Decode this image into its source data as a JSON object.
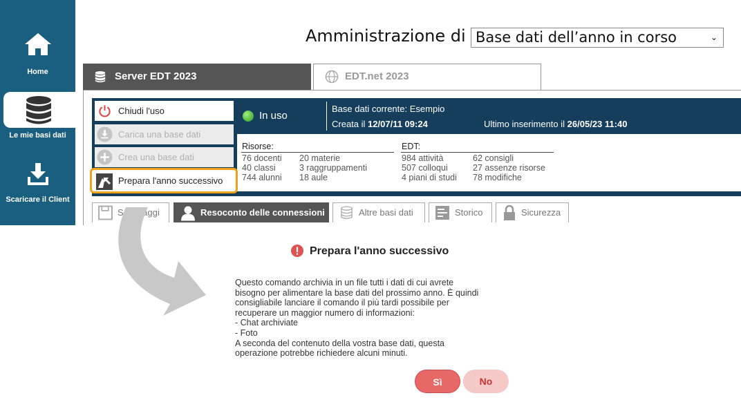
{
  "sidebar": {
    "items": [
      {
        "label": "Home",
        "icon": "home-icon"
      },
      {
        "label": "Le mie basi dati",
        "icon": "database-icon"
      },
      {
        "label": "Scaricare il Client",
        "icon": "download-icon"
      }
    ]
  },
  "header": {
    "admin_label": "Amministrazione di",
    "admin_select_value": "Base dati dell’anno in corso"
  },
  "tabs": {
    "server": "Server EDT 2023",
    "edtnet": "EDT.net 2023"
  },
  "actions": {
    "chiudi": "Chiudi l'uso",
    "carica": "Carica una base dati",
    "crea": "Crea una base dati",
    "prepara": "Prepara l'anno successivo"
  },
  "status": {
    "in_uso": "In uso",
    "base_corrente": "Base dati corrente: Esempio",
    "creata_label": "Creata il",
    "creata_value": "12/07/11 09:24",
    "ultimo_label": "Ultimo inserimento il",
    "ultimo_value": "26/05/23 11:40"
  },
  "risorse": {
    "title": "Risorse:",
    "col1": [
      "76 docenti",
      "40 classi",
      "744 alunni"
    ],
    "col2": [
      "20 materie",
      "3 raggruppamenti",
      "18 aule"
    ]
  },
  "edt": {
    "title": "EDT:",
    "col1": [
      "984 attività",
      "507 colloqui",
      "4 piani di studi"
    ],
    "col2": [
      "62 consigli",
      "27 assenze risorse",
      "78 modifiche"
    ]
  },
  "subtabs": [
    "Salvataggi",
    "Resoconto delle connessioni",
    "Altre basi dati",
    "Storico",
    "Sicurezza"
  ],
  "dialog": {
    "title": "Prepara l'anno successivo",
    "body": "Questo comando archivia in un file tutti i dati di cui avrete\nbisogno per alimentare la base dati del prossimo anno. È quindi\nconsigliabile lanciare il comando il più tardi possibile per\nrecuperare un maggior numero di informazioni:\n- Chat archiviate\n- Foto\nA seconda del contenuto della vostra base dati, questa\noperazione potrebbe richiedere alcuni minuti.",
    "yes": "Sì",
    "no": "No"
  },
  "colors": {
    "sidebar": "#1a5f7f",
    "panel": "#153e5c",
    "highlight": "#f0a21b",
    "danger": "#e86767"
  }
}
